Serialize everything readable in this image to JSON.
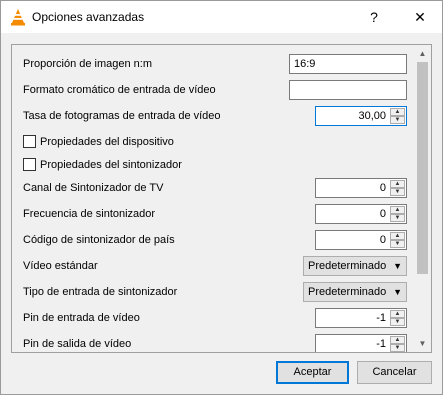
{
  "window": {
    "title": "Opciones avanzadas",
    "help": "?",
    "close": "✕"
  },
  "fields": {
    "aspect_ratio": {
      "label": "Proporción de imagen n:m",
      "value": "16:9"
    },
    "chroma_format": {
      "label": "Formato cromático de entrada de vídeo",
      "value": ""
    },
    "fps": {
      "label": "Tasa de fotogramas de entrada de vídeo",
      "value": "30,00"
    },
    "device_props": {
      "label": "Propiedades del dispositivo",
      "checked": false
    },
    "tuner_props": {
      "label": "Propiedades del sintonizador",
      "checked": false
    },
    "tv_channel": {
      "label": "Canal de Sintonizador de TV",
      "value": "0"
    },
    "tuner_freq": {
      "label": "Frecuencia de sintonizador",
      "value": "0"
    },
    "country_code": {
      "label": "Código de sintonizador de país",
      "value": "0"
    },
    "video_standard": {
      "label": "Vídeo estándar",
      "value": "Predeterminado"
    },
    "tuner_input_type": {
      "label": "Tipo de entrada de sintonizador",
      "value": "Predeterminado"
    },
    "video_in_pin": {
      "label": "Pin de entrada de vídeo",
      "value": "-1"
    },
    "video_out_pin": {
      "label": "Pin de salida de vídeo",
      "value": "-1"
    }
  },
  "buttons": {
    "accept": "Aceptar",
    "cancel": "Cancelar"
  },
  "icons": {
    "app": "vlc-cone-icon",
    "spin_up": "▲",
    "spin_down": "▼",
    "combo_caret": "▼",
    "scroll_up": "▲",
    "scroll_down": "▼"
  },
  "colors": {
    "focus_border": "#0078d7",
    "vlc_orange": "#f48b00"
  }
}
